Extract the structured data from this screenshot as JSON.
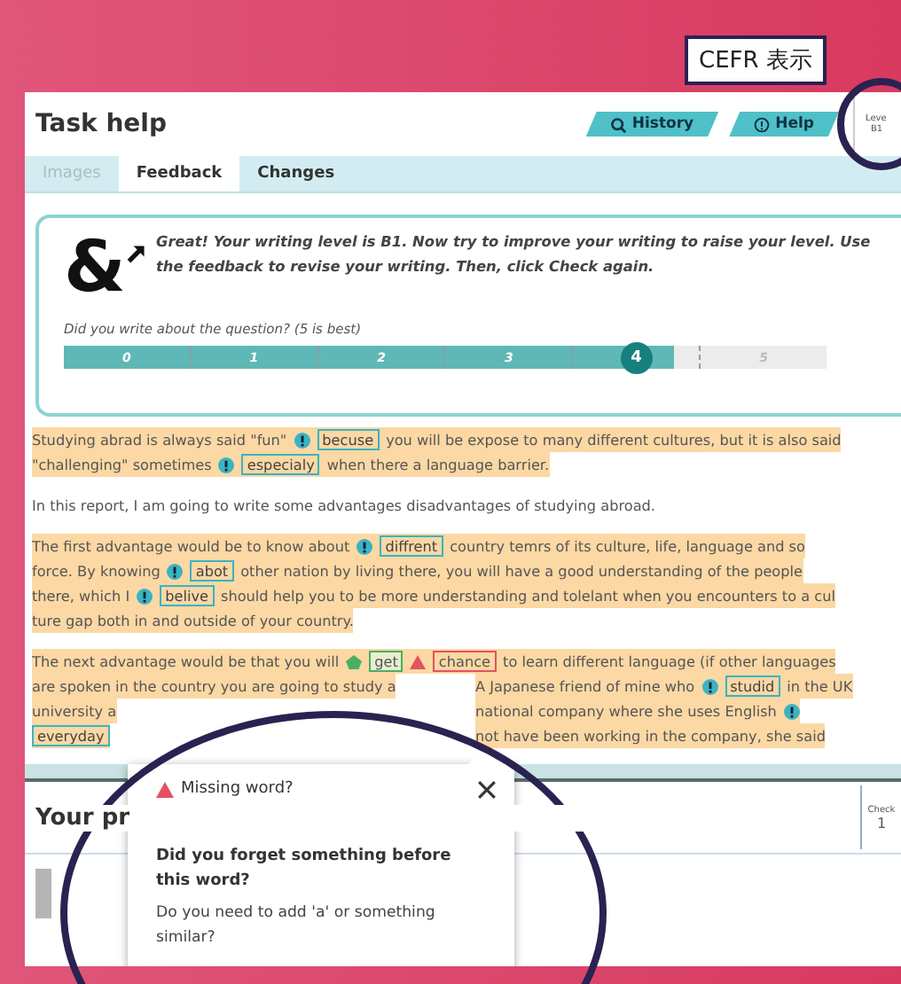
{
  "callout": {
    "text": "CEFR 表示"
  },
  "header": {
    "title": "Task help",
    "buttons": [
      {
        "kind": "history",
        "label": "History"
      },
      {
        "kind": "help",
        "label": "Help"
      }
    ],
    "level": {
      "label": "Leve",
      "value": "B1"
    }
  },
  "tabs": [
    {
      "label": "Images",
      "selected": false,
      "disabled": true
    },
    {
      "label": "Feedback",
      "selected": true,
      "disabled": false
    },
    {
      "label": "Changes",
      "selected": false,
      "disabled": false
    }
  ],
  "feedback": {
    "logo": "&",
    "message": "Great! Your writing level is B1. Now try to improve your writing to raise your level. Use the feedback to revise your writing. Then, click Check again.",
    "question": "Did you write about the question? (5 is best)",
    "scale": {
      "level": 0.8,
      "ticks": [
        {
          "label": "0",
          "selected": false
        },
        {
          "label": "1",
          "selected": false
        },
        {
          "label": "2",
          "selected": false
        },
        {
          "label": "3",
          "selected": false
        },
        {
          "label": "4",
          "selected": true
        },
        {
          "label": "5",
          "selected": false
        }
      ]
    }
  },
  "essay": [
    {
      "highlighted": true,
      "lines": [
        [
          [
            {
              "kind": "text",
              "text": "Studying abrad is always said \"fun\""
            },
            {
              "kind": "error_icon"
            },
            {
              "kind": "error_word",
              "text": "becuse"
            },
            {
              "kind": "text",
              "text": "you will be expose to many different cultures, but it is also said"
            }
          ]
        ],
        [
          [
            {
              "kind": "text",
              "text": "\"challenging\" sometimes"
            },
            {
              "kind": "error_icon"
            },
            {
              "kind": "error_word",
              "text": "especialy"
            },
            {
              "kind": "text",
              "text": "when there a language barrier."
            }
          ]
        ]
      ]
    },
    {
      "highlighted": false,
      "lines": [
        [
          [
            {
              "kind": "text",
              "text": "In this report, I am going to write some advantages disadvantages of studying abroad."
            }
          ]
        ]
      ]
    },
    {
      "highlighted": true,
      "lines": [
        [
          [
            {
              "kind": "text",
              "text": "The first advantage would be to know about"
            },
            {
              "kind": "error_icon"
            },
            {
              "kind": "error_word",
              "text": "diffrent"
            },
            {
              "kind": "text",
              "text": "country temrs of its culture, life, language and so"
            }
          ]
        ],
        [
          [
            {
              "kind": "text",
              "text": "force. By knowing"
            },
            {
              "kind": "error_icon"
            },
            {
              "kind": "error_word",
              "text": "abot"
            },
            {
              "kind": "text",
              "text": "other nation by living there, you will have a good understanding of the people"
            }
          ]
        ],
        [
          [
            {
              "kind": "text",
              "text": "there, which I"
            },
            {
              "kind": "error_icon"
            },
            {
              "kind": "error_word",
              "text": "belive"
            },
            {
              "kind": "text",
              "text": "should help you to be more understanding and tolelant when you encounters to a cul"
            }
          ]
        ],
        [
          [
            {
              "kind": "text",
              "text": "ture gap both in and outside of your country."
            }
          ]
        ]
      ]
    },
    {
      "highlighted": true,
      "lines": [
        [
          [
            {
              "kind": "text",
              "text": "The next advantage would be that you will"
            },
            {
              "kind": "good_icon"
            },
            {
              "kind": "good_word",
              "text": "get"
            },
            {
              "kind": "missing_icon"
            },
            {
              "kind": "missing_word",
              "text": "chance"
            },
            {
              "kind": "text",
              "text": "to learn different language (if other languages"
            }
          ]
        ],
        [
          [
            {
              "kind": "text",
              "text": "are spoken in the country you are going to study a"
            }
          ],
          [
            {
              "kind": "text",
              "text": "A Japanese friend of mine who"
            },
            {
              "kind": "error_icon"
            },
            {
              "kind": "error_word",
              "text": "studid"
            },
            {
              "kind": "text",
              "text": "in the UK"
            }
          ]
        ],
        [
          [
            {
              "kind": "text",
              "text": "university a"
            }
          ],
          [
            {
              "kind": "text",
              "text": "national company where she uses English"
            },
            {
              "kind": "error_icon"
            }
          ]
        ],
        [
          [
            {
              "kind": "error_word",
              "text": "everyday"
            }
          ],
          [
            {
              "kind": "text",
              "text": "not have been working in the company, she said"
            }
          ]
        ]
      ]
    }
  ],
  "progress": {
    "title": "Your pr",
    "check": {
      "label": "Check",
      "value": "1"
    }
  },
  "popup": {
    "title": "Missing word?",
    "question": "Did you forget something before this word?",
    "hint": "Do you need to add 'a' or something similar?"
  }
}
